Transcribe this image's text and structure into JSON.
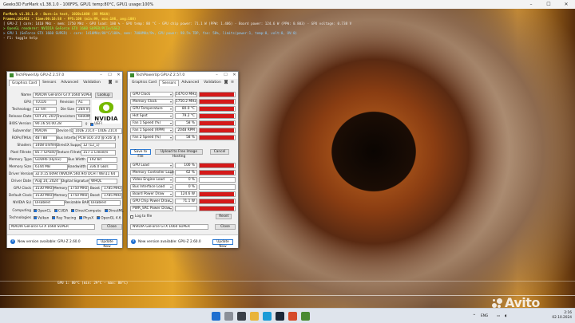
{
  "furmark": {
    "title": "Geeks3D FurMark v1.38.1.0 - 100FPS, GPU1 temp:80°C, GPU1 usage:100%",
    "overlay": [
      "FurMark v1.38.1.0 - Burn-in test, 1920x1080 (8X MSAA)",
      "Frames:101432 - time:00:16:58 - FPS:100 (min:99, max:106, avg:100)",
      "[ GPU-Z ] core: 1410 MHz - mem: 1750 MHz - GPU load: 100 % - GPU temp: 80 °C - GPU chip power: 71.1 W (PPW: 1.406) - Board power: 124.6 W (PPW: 0.803) - GPU voltage: 0.738 V",
      "> OpenGL renderer: NVIDIA GeForce GTX 1660 SUPER/PCIe/SSE2",
      "> GPU 1 (GeForce GTX 1660 SUPER) - core: 1410MHz/80°C/100%, mem: 7000MHz/9%, GPU power: 98.5% TDP, fan: 58%, limits(power:1, temp:0, volt:0, OV:0)",
      "- F1: toggle help"
    ],
    "graph_label": "GPU 1: 80°C (min: 29°C - max: 80°C)"
  },
  "gpuz_card": {
    "title": "TechPowerUp GPU-Z 2.57.0",
    "tabs": [
      "Graphics Card",
      "Sensors",
      "Advanced",
      "Validation"
    ],
    "lookup_label": "Lookup",
    "uefi_label": "UEFI",
    "nvidia_wordmark": "NVIDIA",
    "fields": {
      "name_label": "Name",
      "name": "NVIDIA GeForce GTX 1660 SUPER",
      "gpu_label": "GPU",
      "gpu": "TU116",
      "revision_label": "Revision",
      "revision": "A1",
      "technology_label": "Technology",
      "technology": "12 nm",
      "die_size_label": "Die Size",
      "die_size": "284 mm²",
      "release_date_label": "Release Date",
      "release_date": "Oct 29, 2019",
      "transistors_label": "Transistors",
      "transistors": "6600M",
      "bios_label": "BIOS Version",
      "bios": "90.16.50.00.28",
      "subvendor_label": "Subvendor",
      "subvendor": "NVIDIA",
      "device_id_label": "Device ID",
      "device_id": "10DE 21C4 - 10DE 21C4",
      "rops_label": "ROPs/TMUs",
      "rops": "48 / 88",
      "bus_label": "Bus Interface",
      "bus": "PCIe x16 3.0 @ x16 3.0",
      "shaders_label": "Shaders",
      "shaders": "1408 Unified",
      "directx_label": "DirectX Support",
      "directx": "12 (12_1)",
      "pixel_label": "Pixel Fillrate",
      "pixel": "85.7 GPixel/s",
      "texture_label": "Texture Fillrate",
      "texture": "157.1 GTexel/s",
      "memtype_label": "Memory Type",
      "memtype": "GDDR6 (Hynix)",
      "buswidth_label": "Bus Width",
      "buswidth": "192 bit",
      "memsize_label": "Memory Size",
      "memsize": "6144 MB",
      "bandwidth_label": "Bandwidth",
      "bandwidth": "336.0 GB/s",
      "driver_label": "Driver Version",
      "driver": "32.0.15.6094 (NVIDIA 560.94) DCH / Win11 64",
      "driver_date_label": "Driver Date",
      "driver_date": "Aug 14, 2024",
      "signature_label": "Digital Signature",
      "signature": "WHQL",
      "gpuclock_label": "GPU Clock",
      "gpuclock": "1530 MHz",
      "memory_label": "Memory",
      "memory": "1750 MHz",
      "boost_label": "Boost",
      "boost": "1785 MHz",
      "defclock_label": "Default Clock",
      "defclock": "1530 MHz",
      "defmemory": "1750 MHz",
      "defboost": "1785 MHz",
      "sli_label": "NVIDIA SLI",
      "sli": "Disabled",
      "rebar_label": "Resizable BAR",
      "rebar": "Disabled",
      "computing_label": "Computing",
      "technologies_label": "Technologies"
    },
    "computing": [
      "OpenCL",
      "CUDA",
      "DirectCompute",
      "DirectML"
    ],
    "technologies": [
      "Vulkan",
      "Ray Tracing",
      "PhysX",
      "OpenGL 4.6"
    ],
    "gpu_select": "NVIDIA GeForce GTX 1660 SUPER",
    "close_label": "Close",
    "notice": "New version available: GPU-Z 2.60.0",
    "update_label": "Update Now"
  },
  "gpuz_sensors": {
    "title": "TechPowerUp GPU-Z 2.57.0",
    "tabs": [
      "Graphics Card",
      "Sensors",
      "Advanced",
      "Validation"
    ],
    "top_sensors": [
      {
        "name": "GPU Clock",
        "value": "1470.0 MHz",
        "level": 0.98
      },
      {
        "name": "Memory Clock",
        "value": "1750.2 MHz",
        "level": 0.98
      },
      {
        "name": "GPU Temperature",
        "value": "80.0 °C",
        "level": 0.98
      },
      {
        "name": "Hot Spot",
        "value": "79.2 °C",
        "level": 0.98
      },
      {
        "name": "Fan 1 Speed (%)",
        "value": "58 %",
        "level": 0.98
      },
      {
        "name": "Fan 1 Speed (RPM)",
        "value": "2048 RPM",
        "level": 0.98
      },
      {
        "name": "Fan 2 Speed (%)",
        "value": "58 %",
        "level": 0.98
      }
    ],
    "save_label": "Save to File",
    "upload_label": "Upload to Free Image Hosting",
    "cancel_label": "Cancel",
    "bottom_sensors": [
      {
        "name": "GPU Load",
        "value": "100 %",
        "level": 0.98
      },
      {
        "name": "Memory Controller Load",
        "value": "62 %",
        "level": 0.98
      },
      {
        "name": "Video Engine Load",
        "value": "0 %",
        "level": 0
      },
      {
        "name": "Bus Interface Load",
        "value": "0 %",
        "level": 0
      },
      {
        "name": "Board Power Draw",
        "value": "124.6 W",
        "level": 0.98
      },
      {
        "name": "GPU Chip Power Draw",
        "value": "71.1 W",
        "level": 0.98
      },
      {
        "name": "PWR_SRC Power Draw",
        "value": "",
        "level": 0.98
      }
    ],
    "log_label": "Log to file",
    "reset_label": "Reset",
    "gpu_select": "NVIDIA GeForce GTX 1660 SUPER",
    "close_label": "Close",
    "notice": "New version available: GPU-Z 2.60.0",
    "update_label": "Update Now"
  },
  "taskbar": {
    "lang": "ENG",
    "time": "2:16",
    "date": "02.10.2024"
  },
  "watermark": "Avito",
  "colors": {
    "sensor_bar": "#d41a1a",
    "nvidia_green": "#76b900"
  }
}
